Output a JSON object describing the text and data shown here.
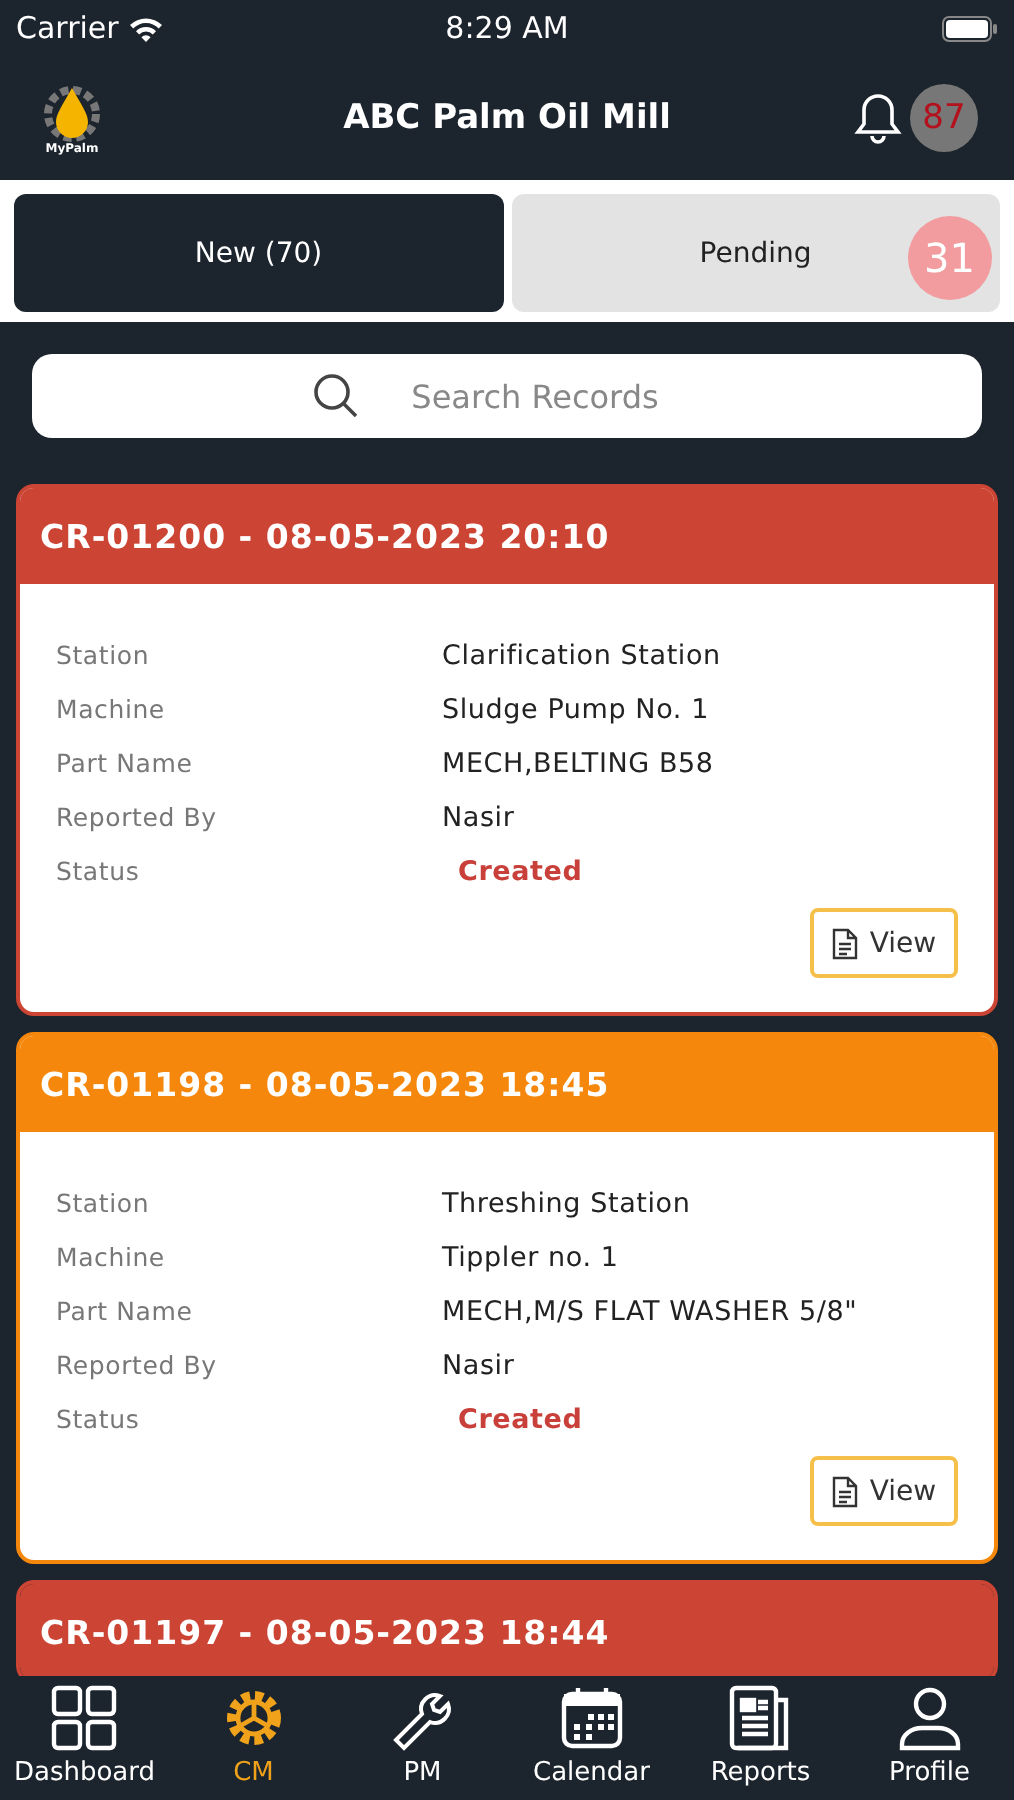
{
  "status_bar": {
    "carrier": "Carrier",
    "time": "8:29 AM"
  },
  "header": {
    "logo_text": "MyPalm",
    "title": "ABC Palm Oil Mill",
    "notification_count": "87"
  },
  "tabs": [
    {
      "label": "New (70)",
      "selected": true
    },
    {
      "label": "Pending",
      "selected": false,
      "badge": "31"
    }
  ],
  "search": {
    "placeholder": "Search Records"
  },
  "records": [
    {
      "title": "CR-01200 - 08-05-2023 20:10",
      "color": "#cc4433",
      "fields": [
        {
          "label": "Station",
          "value": "Clarification Station"
        },
        {
          "label": "Machine",
          "value": "Sludge Pump No. 1"
        },
        {
          "label": "Part Name",
          "value": "MECH,BELTING B58"
        },
        {
          "label": "Reported By",
          "value": "Nasir"
        },
        {
          "label": "Status",
          "value": "Created",
          "kind": "status"
        }
      ],
      "button": "View"
    },
    {
      "title": "CR-01198 - 08-05-2023 18:45",
      "color": "#f5880c",
      "fields": [
        {
          "label": "Station",
          "value": "Threshing Station"
        },
        {
          "label": "Machine",
          "value": "Tippler no. 1"
        },
        {
          "label": "Part Name",
          "value": "MECH,M/S FLAT WASHER 5/8\""
        },
        {
          "label": "Reported By",
          "value": "Nasir"
        },
        {
          "label": "Status",
          "value": "Created",
          "kind": "status"
        }
      ],
      "button": "View"
    },
    {
      "title": "CR-01197 - 08-05-2023 18:44",
      "color": "#cc4433"
    }
  ],
  "nav": [
    {
      "label": "Dashboard",
      "selected": false
    },
    {
      "label": "CM",
      "selected": true
    },
    {
      "label": "PM",
      "selected": false
    },
    {
      "label": "Calendar",
      "selected": false
    },
    {
      "label": "Reports",
      "selected": false
    },
    {
      "label": "Profile",
      "selected": false
    }
  ]
}
